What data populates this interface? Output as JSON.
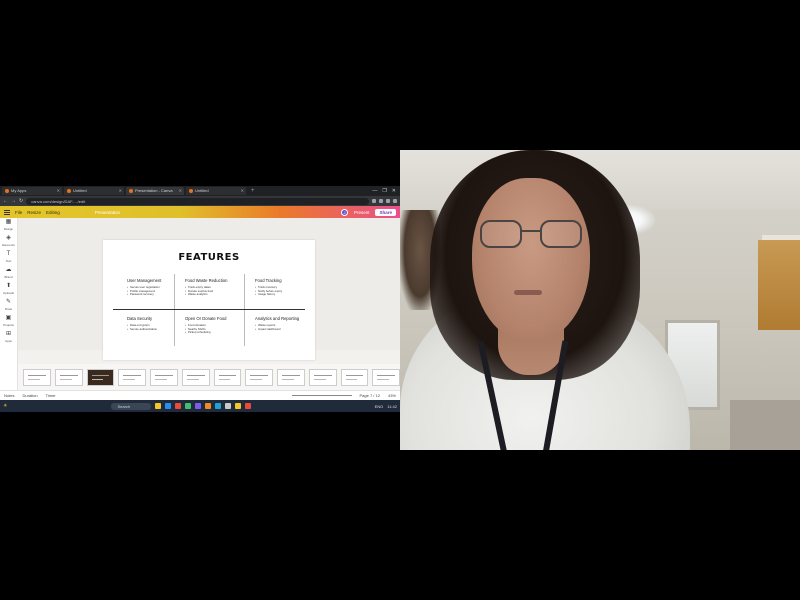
{
  "browser": {
    "tabs": [
      {
        "label": "My Apps",
        "active": false
      },
      {
        "label": "Untitled",
        "active": false
      },
      {
        "label": "Presentation - Canva",
        "active": true
      },
      {
        "label": "Untitled",
        "active": false
      }
    ],
    "url": "canva.com/design/DAF...../edit",
    "window_controls": [
      "—",
      "❐",
      "✕"
    ]
  },
  "app": {
    "menu": [
      "File",
      "Resize",
      "Editing"
    ],
    "doc_title": "Presentation",
    "present_label": "Present",
    "share_label": "Share",
    "avatar_initial": "J"
  },
  "sidebar": {
    "items": [
      {
        "icon": "▦",
        "label": "Design"
      },
      {
        "icon": "◈",
        "label": "Elements"
      },
      {
        "icon": "T",
        "label": "Text"
      },
      {
        "icon": "☁",
        "label": "Brand"
      },
      {
        "icon": "⬆",
        "label": "Uploads"
      },
      {
        "icon": "✎",
        "label": "Draw"
      },
      {
        "icon": "▣",
        "label": "Projects"
      },
      {
        "icon": "⊞",
        "label": "Apps"
      }
    ]
  },
  "slide": {
    "title": "FEATURES",
    "features": [
      {
        "heading": "User Management",
        "bullets": [
          "Secure user registration",
          "Profile management",
          "Password recovery"
        ]
      },
      {
        "heading": "Food Waste Reduction",
        "bullets": [
          "Track expiry dates",
          "Donate surplus food",
          "Waste analytics"
        ]
      },
      {
        "heading": "Food Tracking",
        "bullets": [
          "Track inventory",
          "Notify before expiry",
          "Usage history"
        ]
      },
      {
        "heading": "Data Security",
        "bullets": [
          "Data encryption",
          "Secure authentication"
        ]
      },
      {
        "heading": "Open Or Donate Food",
        "bullets": [
          "Food donation",
          "Nearby NGOs",
          "Pickup scheduling"
        ]
      },
      {
        "heading": "Analytics and Reporting",
        "bullets": [
          "Waste reports",
          "Impact dashboard"
        ]
      }
    ]
  },
  "filmstrip": {
    "count": 12
  },
  "status": {
    "notes_label": "Notes",
    "duration_label": "Duration",
    "timer_label": "Timer",
    "page_label": "Page 7 / 12",
    "zoom": "43%"
  },
  "taskbar": {
    "search_placeholder": "Search",
    "tray_time": "11:42",
    "tray_lang": "ENG",
    "icon_colors": [
      "#f3c623",
      "#2a8cf0",
      "#e84a3c",
      "#3fbf6b",
      "#7a5cf0",
      "#f08a24",
      "#1fa3d6",
      "#c9c9c9",
      "#f3c623",
      "#e84a3c"
    ]
  },
  "camera": {
    "description_label": ""
  }
}
